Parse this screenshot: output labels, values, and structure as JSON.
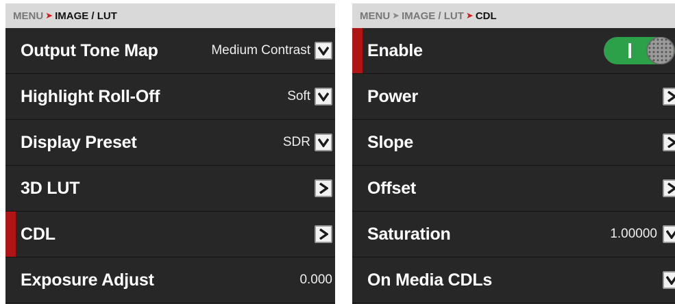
{
  "left_panel": {
    "breadcrumb": {
      "root": "MENU",
      "current": "IMAGE / LUT"
    },
    "rows": [
      {
        "label": "Output Tone Map",
        "value": "Medium Contrast",
        "control": "dropdown"
      },
      {
        "label": "Highlight Roll-Off",
        "value": "Soft",
        "control": "dropdown"
      },
      {
        "label": "Display Preset",
        "value": "SDR",
        "control": "dropdown"
      },
      {
        "label": "3D LUT",
        "value": "",
        "control": "submenu"
      },
      {
        "label": "CDL",
        "value": "",
        "control": "submenu",
        "selected": true
      },
      {
        "label": "Exposure Adjust",
        "value": "0.000",
        "control": "none"
      }
    ]
  },
  "right_panel": {
    "breadcrumb": {
      "root": "MENU",
      "middle": "IMAGE / LUT",
      "current": "CDL"
    },
    "rows": [
      {
        "label": "Enable",
        "value": "",
        "control": "toggle",
        "toggle_on": true,
        "selected": true
      },
      {
        "label": "Power",
        "value": "",
        "control": "submenu"
      },
      {
        "label": "Slope",
        "value": "",
        "control": "submenu"
      },
      {
        "label": "Offset",
        "value": "",
        "control": "submenu"
      },
      {
        "label": "Saturation",
        "value": "1.00000",
        "control": "dropdown"
      },
      {
        "label": "On Media CDLs",
        "value": "",
        "control": "dropdown"
      }
    ]
  },
  "colors": {
    "panel_bg": "#272727",
    "header_bg": "#d9d9d9",
    "accent_red": "#b01515",
    "toggle_green": "#2da14a"
  }
}
